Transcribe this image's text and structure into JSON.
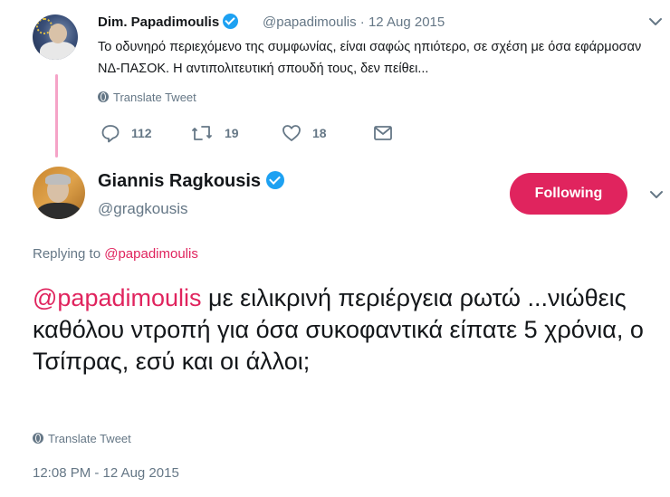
{
  "parent_tweet": {
    "author_name": "Dim. Papadimoulis",
    "handle": "@papadimoulis",
    "separator": "·",
    "date": "12 Aug 2015",
    "text": "Το οδυνηρό περιεχόμενο της συμφωνίας, είναι σαφώς ηπιότερο, σε σχέση με όσα εφάρμοσαν ΝΔ-ΠΑΣΟΚ. Η αντιπολιτευτική σπουδή τους, δεν πείθει...",
    "translate_label": "Translate Tweet",
    "replies_count": "112",
    "retweets_count": "19",
    "likes_count": "18"
  },
  "main_tweet": {
    "author_name": "Giannis Ragkousis",
    "handle": "@gragkousis",
    "follow_label": "Following",
    "replying_prefix": "Replying to",
    "replying_to": "@papadimoulis",
    "mention": "@papadimoulis",
    "text": " με ειλικρινή περιέργεια ρωτώ ...νιώθεις καθόλου ντροπή για όσα συκοφαντικά είπατε 5 χρόνια, ο Τσίπρας, εσύ και οι άλλοι;",
    "translate_label": "Translate Tweet",
    "timestamp": "12:08 PM - 12 Aug 2015"
  },
  "colors": {
    "accent": "#e0245e",
    "verified": "#1da1f2",
    "muted": "#657786",
    "thread_line": "#f5a3c7"
  },
  "icons": [
    "verified-badge-icon",
    "chevron-down-icon",
    "globe-icon",
    "reply-icon",
    "retweet-icon",
    "like-icon",
    "dm-icon"
  ]
}
